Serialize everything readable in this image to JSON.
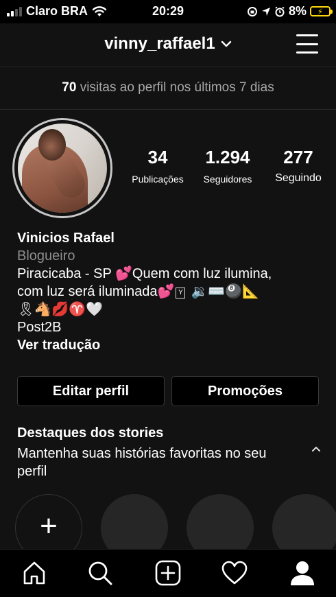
{
  "status_bar": {
    "carrier": "Claro BRA",
    "time": "20:29",
    "battery_percent": "8%"
  },
  "header": {
    "username": "vinny_raffael1"
  },
  "visits": {
    "count": "70",
    "text": " visitas ao perfil nos últimos 7 dias"
  },
  "stats": [
    {
      "value": "34",
      "label": "Publicações"
    },
    {
      "value": "1.294",
      "label": "Seguidores"
    },
    {
      "value": "277",
      "label": "Seguindo"
    }
  ],
  "bio": {
    "name": "Vinicios Rafael",
    "category": "Blogueiro",
    "line1": "Piracicaba - SP 💕Quem com luz ilumina,",
    "line2_text": "com luz será iluminada💕",
    "line2_keycap": "Y",
    "line2_emoji": "🔉⌨️🎱📐",
    "line3": "🎗🐴💋♈️🤍",
    "link": "Post2B",
    "translate": "Ver tradução"
  },
  "buttons": {
    "edit_profile": "Editar perfil",
    "promotions": "Promoções"
  },
  "highlights": {
    "title": "Destaques dos stories",
    "subtitle": "Mantenha suas histórias favoritas no seu perfil",
    "add_symbol": "+"
  },
  "colors": {
    "background": "#121212",
    "battery": "#ffd60a",
    "muted_text": "#8e8e8e"
  },
  "tabs": [
    "home-icon",
    "search-icon",
    "new-post-icon",
    "activity-heart-icon",
    "profile-icon"
  ]
}
